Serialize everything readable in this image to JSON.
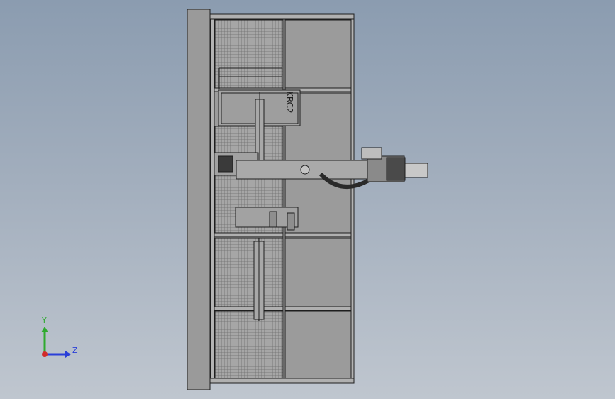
{
  "viewport": {
    "background_top": "#8b9cb0",
    "background_bottom": "#bfc6cf"
  },
  "model": {
    "label_text": "KRC2",
    "frame_color": "#9a9a9a",
    "line_color": "#1e1e1e",
    "mesh_color": "#7d7d7d"
  },
  "triad": {
    "y_label": "Y",
    "z_label": "Z",
    "y_color": "#2faa2f",
    "z_color": "#2a3fd8",
    "origin_color": "#d22a2a"
  }
}
